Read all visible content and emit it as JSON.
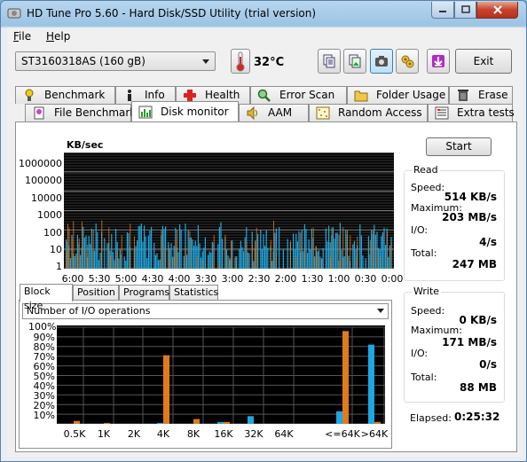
{
  "window": {
    "title": "HD Tune Pro 5.60 - Hard Disk/SSD Utility (trial version)"
  },
  "menu": {
    "file": "File",
    "file_key": "F",
    "file_rest": "ile",
    "help": "Help",
    "help_key": "H",
    "help_rest": "elp"
  },
  "toolbar": {
    "drive": "ST3160318AS (160 gB)",
    "temperature": "32°C",
    "exit_label": "Exit",
    "buttons": [
      "copy-text-icon",
      "copy-image-icon",
      "camera-icon",
      "options-icon",
      "save-icon"
    ]
  },
  "tabs_row1": [
    {
      "label": "Benchmark",
      "icon": "benchmark-icon"
    },
    {
      "label": "Info",
      "icon": "info-icon"
    },
    {
      "label": "Health",
      "icon": "health-icon"
    },
    {
      "label": "Error Scan",
      "icon": "error-scan-icon"
    },
    {
      "label": "Folder Usage",
      "icon": "folder-icon"
    },
    {
      "label": "Erase",
      "icon": "erase-icon"
    }
  ],
  "tabs_row2": [
    {
      "label": "File Benchmark",
      "icon": "file-benchmark-icon"
    },
    {
      "label": "Disk monitor",
      "icon": "disk-monitor-icon",
      "selected": true
    },
    {
      "label": "AAM",
      "icon": "speaker-icon"
    },
    {
      "label": "Random Access",
      "icon": "random-access-icon"
    },
    {
      "label": "Extra tests",
      "icon": "extra-tests-icon"
    }
  ],
  "monitor": {
    "unit": "KB/sec",
    "y_ticks": [
      "1000000",
      "100000",
      "10000",
      "1000",
      "100",
      "10",
      "1"
    ],
    "x_ticks": [
      "6:00",
      "5:30",
      "5:00",
      "4:30",
      "4:00",
      "3:30",
      "3:00",
      "2:30",
      "2:00",
      "1:30",
      "1:00",
      "0:30",
      "0:00"
    ],
    "colors": {
      "read": "#1ea7e1",
      "write": "#e07b1c",
      "background": "#000000"
    }
  },
  "start_label": "Start",
  "read": {
    "title": "Read",
    "speed_label": "Speed:",
    "speed": "514 KB/s",
    "max_label": "Maximum:",
    "max": "203 MB/s",
    "io_label": "I/O:",
    "io": "4/s",
    "total_label": "Total:",
    "total": "247 MB"
  },
  "write": {
    "title": "Write",
    "speed_label": "Speed:",
    "speed": "0 KB/s",
    "max_label": "Maximum:",
    "max": "171 MB/s",
    "io_label": "I/O:",
    "io": "0/s",
    "total_label": "Total:",
    "total": "88 MB"
  },
  "subtabs": [
    "Block size",
    "Position",
    "Programs",
    "Statistics"
  ],
  "op_select": "Number of I/O operations",
  "elapsed_label": "Elapsed:",
  "elapsed": "0:25:32",
  "chart_data": {
    "type": "bar",
    "categories": [
      "0.5K",
      "1K",
      "2K",
      "4K",
      "8K",
      "16K",
      "32K",
      "64K",
      "<=64K",
      ">64K"
    ],
    "y_ticks": [
      "100%",
      "90%",
      "80%",
      "70%",
      "60%",
      "50%",
      "40%",
      "30%",
      "20%",
      "10%"
    ],
    "ylim": [
      0,
      100
    ],
    "series": [
      {
        "color": "#1ea7e1",
        "values": [
          0,
          0,
          0,
          1,
          0,
          2,
          8,
          0,
          13,
          82
        ]
      },
      {
        "color": "#e07b1c",
        "values": [
          3,
          1,
          0,
          71,
          5,
          2,
          0,
          0,
          96,
          2
        ]
      }
    ]
  }
}
